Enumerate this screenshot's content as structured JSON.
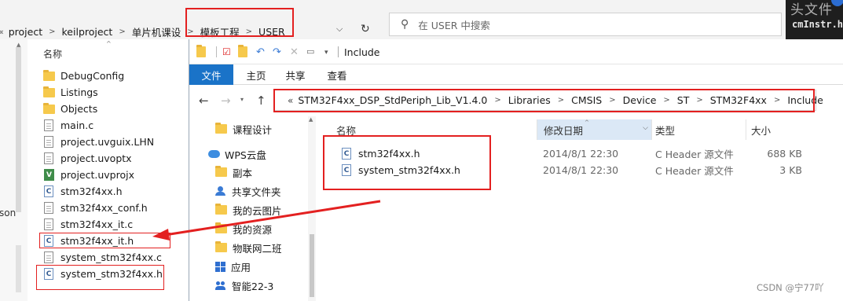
{
  "background_window": {
    "breadcrumb": [
      "project",
      "keilproject",
      "单片机课设",
      "模板工程",
      "USER"
    ],
    "breadcrumb_prefix": "«",
    "search_placeholder": "在 USER 中搜索",
    "right_panel_text_1": "头文件",
    "right_panel_text_2": "cmInstr.h",
    "left_edge_text": "son",
    "list_header": "名称",
    "files": [
      {
        "name": "DebugConfig",
        "icon": "folder-icon"
      },
      {
        "name": "Listings",
        "icon": "folder-icon"
      },
      {
        "name": "Objects",
        "icon": "folder-icon"
      },
      {
        "name": "main.c",
        "icon": "document-icon"
      },
      {
        "name": "project.uvguix.LHN",
        "icon": "document-icon"
      },
      {
        "name": "project.uvoptx",
        "icon": "document-icon"
      },
      {
        "name": "project.uvprojx",
        "icon": "keil-project-icon"
      },
      {
        "name": "stm32f4xx.h",
        "icon": "c-header-icon"
      },
      {
        "name": "stm32f4xx_conf.h",
        "icon": "document-icon"
      },
      {
        "name": "stm32f4xx_it.c",
        "icon": "document-icon"
      },
      {
        "name": "stm32f4xx_it.h",
        "icon": "c-header-icon"
      },
      {
        "name": "system_stm32f4xx.c",
        "icon": "document-icon"
      },
      {
        "name": "system_stm32f4xx.h",
        "icon": "c-header-icon"
      }
    ]
  },
  "foreground_window": {
    "title": "Include",
    "ribbon_tabs": [
      "文件",
      "主页",
      "共享",
      "查看"
    ],
    "address_prefix": "«",
    "address_path": [
      "STM32F4xx_DSP_StdPeriph_Lib_V1.4.0",
      "Libraries",
      "CMSIS",
      "Device",
      "ST",
      "STM32F4xx",
      "Include"
    ],
    "nav_items": [
      {
        "label": "课程设计",
        "icon": "folder-icon"
      },
      {
        "label": "WPS云盘",
        "icon": "cloud-icon"
      },
      {
        "label": "副本",
        "icon": "folder-icon"
      },
      {
        "label": "共享文件夹",
        "icon": "shared-folder-icon"
      },
      {
        "label": "我的云图片",
        "icon": "folder-icon"
      },
      {
        "label": "我的资源",
        "icon": "folder-icon"
      },
      {
        "label": "物联网二班",
        "icon": "folder-icon"
      },
      {
        "label": "应用",
        "icon": "apps-icon"
      },
      {
        "label": "智能22-3",
        "icon": "group-icon"
      }
    ],
    "columns": {
      "name": "名称",
      "date": "修改日期",
      "type": "类型",
      "size": "大小"
    },
    "files": [
      {
        "name": "stm32f4xx.h",
        "date": "2014/8/1 22:30",
        "type": "C Header 源文件",
        "size": "688 KB"
      },
      {
        "name": "system_stm32f4xx.h",
        "date": "2014/8/1 22:30",
        "type": "C Header 源文件",
        "size": "3 KB"
      }
    ]
  },
  "watermark": "CSDN @宁77吖",
  "colors": {
    "annotation_red": "#e32020",
    "ribbon_file_tab": "#1a73c8",
    "folder_yellow": "#f6c94c"
  }
}
